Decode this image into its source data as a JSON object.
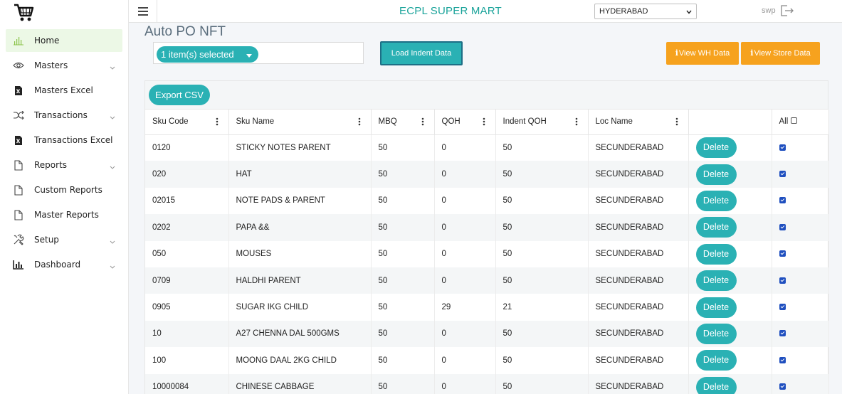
{
  "header": {
    "title": "ECPL SUPER MART",
    "location": "HYDERABAD",
    "user": "swp"
  },
  "sidebar": {
    "items": [
      {
        "label": "Home",
        "icon": "bar-chart-icon",
        "active": true,
        "expandable": false
      },
      {
        "label": "Masters",
        "icon": "eye-icon",
        "active": false,
        "expandable": true
      },
      {
        "label": "Masters Excel",
        "icon": "excel-file-icon",
        "active": false,
        "expandable": false
      },
      {
        "label": "Transactions",
        "icon": "shuffle-icon",
        "active": false,
        "expandable": true
      },
      {
        "label": "Transactions Excel",
        "icon": "excel-file-icon",
        "active": false,
        "expandable": false
      },
      {
        "label": "Reports",
        "icon": "file-icon",
        "active": false,
        "expandable": true
      },
      {
        "label": "Custom Reports",
        "icon": "file-icon",
        "active": false,
        "expandable": false
      },
      {
        "label": "Master Reports",
        "icon": "file-icon",
        "active": false,
        "expandable": false
      },
      {
        "label": "Setup",
        "icon": "tools-icon",
        "active": false,
        "expandable": true
      },
      {
        "label": "Dashboard",
        "icon": "dashboard-chart-icon",
        "active": false,
        "expandable": true
      }
    ]
  },
  "page": {
    "title": "Auto PO NFT",
    "multiselect_label": "1 item(s) selected",
    "load_button": "Load Indent Data",
    "view_wh_button": "View WH Data",
    "view_store_button": "View Store Data",
    "info_glyph": "i",
    "export_button": "Export CSV"
  },
  "table": {
    "columns": [
      "Sku Code",
      "Sku Name",
      "MBQ",
      "QOH",
      "Indent QOH",
      "Loc Name",
      "",
      "All"
    ],
    "delete_label": "Delete",
    "rows": [
      {
        "sku_code": "0120",
        "sku_name": "STICKY NOTES PARENT",
        "mbq": "50",
        "qoh": "0",
        "indent_qoh": "50",
        "loc_name": "SECUNDERABAD",
        "checked": true
      },
      {
        "sku_code": "020",
        "sku_name": "HAT",
        "mbq": "50",
        "qoh": "0",
        "indent_qoh": "50",
        "loc_name": "SECUNDERABAD",
        "checked": true
      },
      {
        "sku_code": "02015",
        "sku_name": "NOTE PADS & PARENT",
        "mbq": "50",
        "qoh": "0",
        "indent_qoh": "50",
        "loc_name": "SECUNDERABAD",
        "checked": true
      },
      {
        "sku_code": "0202",
        "sku_name": "PAPA &&",
        "mbq": "50",
        "qoh": "0",
        "indent_qoh": "50",
        "loc_name": "SECUNDERABAD",
        "checked": true
      },
      {
        "sku_code": "050",
        "sku_name": "MOUSES",
        "mbq": "50",
        "qoh": "0",
        "indent_qoh": "50",
        "loc_name": "SECUNDERABAD",
        "checked": true
      },
      {
        "sku_code": "0709",
        "sku_name": "HALDHI PARENT",
        "mbq": "50",
        "qoh": "0",
        "indent_qoh": "50",
        "loc_name": "SECUNDERABAD",
        "checked": true
      },
      {
        "sku_code": "0905",
        "sku_name": "SUGAR IKG CHILD",
        "mbq": "50",
        "qoh": "29",
        "indent_qoh": "21",
        "loc_name": "SECUNDERABAD",
        "checked": true
      },
      {
        "sku_code": "10",
        "sku_name": "A27 CHENNA DAL 500GMS",
        "mbq": "50",
        "qoh": "0",
        "indent_qoh": "50",
        "loc_name": "SECUNDERABAD",
        "checked": true
      },
      {
        "sku_code": "100",
        "sku_name": "MOONG DAAL 2KG CHILD",
        "mbq": "50",
        "qoh": "0",
        "indent_qoh": "50",
        "loc_name": "SECUNDERABAD",
        "checked": true
      },
      {
        "sku_code": "10000084",
        "sku_name": "CHINESE CABBAGE",
        "mbq": "50",
        "qoh": "0",
        "indent_qoh": "50",
        "loc_name": "SECUNDERABAD",
        "checked": true
      }
    ]
  },
  "colors": {
    "accent_teal": "#2ab1b4",
    "title_teal": "#1aa39a",
    "orange": "#f6a21e",
    "active_nav_bg": "#ecf8e6",
    "checkbox_blue": "#1f4fbf"
  }
}
